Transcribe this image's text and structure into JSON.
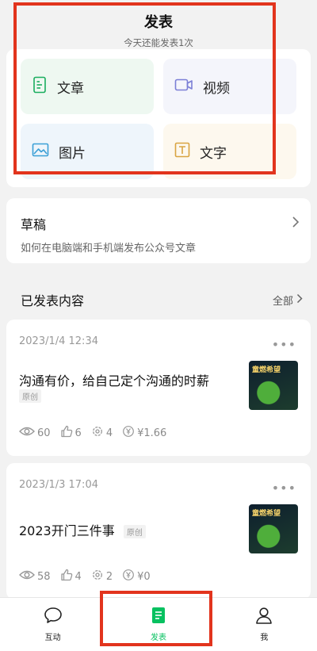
{
  "header": {
    "title": "发表",
    "subtitle": "今天还能发表1次"
  },
  "publish_options": [
    {
      "label": "文章",
      "icon": "article-icon"
    },
    {
      "label": "视频",
      "icon": "video-icon"
    },
    {
      "label": "图片",
      "icon": "image-icon"
    },
    {
      "label": "文字",
      "icon": "text-icon"
    }
  ],
  "draft": {
    "title": "草稿",
    "subtitle": "如何在电脑端和手机端发布公众号文章"
  },
  "published": {
    "title": "已发表内容",
    "all_label": "全部",
    "posts": [
      {
        "date": "2023/1/4 12:34",
        "title": "沟通有价，给自己定个沟通的时薪",
        "badge": "原创",
        "views": "60",
        "likes": "6",
        "shares": "4",
        "earnings": "¥1.66",
        "thumb_text": "童燃希望"
      },
      {
        "date": "2023/1/3 17:04",
        "title": "2023开门三件事",
        "badge": "原创",
        "views": "58",
        "likes": "4",
        "shares": "2",
        "earnings": "¥0",
        "thumb_text": "童燃希望"
      }
    ]
  },
  "tabbar": [
    {
      "label": "互动",
      "icon": "chat-bubble-icon"
    },
    {
      "label": "发表",
      "icon": "document-icon",
      "active": true
    },
    {
      "label": "我",
      "icon": "person-icon"
    }
  ],
  "colors": {
    "accent": "#07c160",
    "highlight": "#e2341d"
  }
}
